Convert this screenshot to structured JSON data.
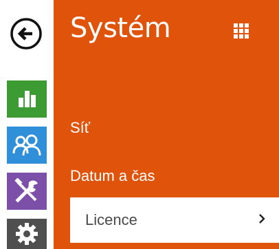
{
  "sidebar": {
    "back_icon": "arrow-left-circle-icon",
    "tiles": [
      {
        "icon": "bar-chart-icon",
        "color": "#3d9b33"
      },
      {
        "icon": "users-icon",
        "color": "#2f8fd8"
      },
      {
        "icon": "tools-icon",
        "color": "#7c50a8"
      },
      {
        "icon": "gear-icon",
        "color": "#4f4f4f"
      }
    ]
  },
  "header": {
    "title": "Systém",
    "grid_icon": "grid-icon",
    "accent_color": "#e0530b"
  },
  "menu": {
    "items": [
      {
        "label": "Síť"
      },
      {
        "label": "Datum a čas"
      },
      {
        "label": "Licence",
        "active": true,
        "chevron_icon": "chevron-right-icon"
      }
    ]
  }
}
